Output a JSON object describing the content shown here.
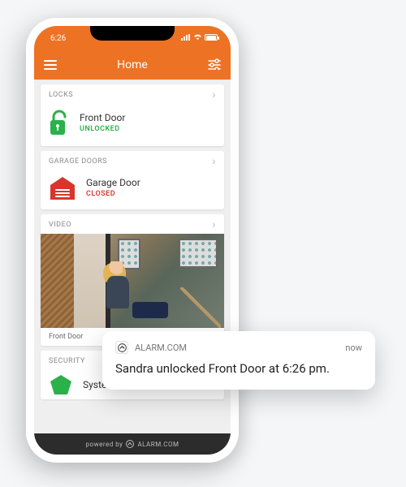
{
  "status_bar": {
    "time": "6:26"
  },
  "header": {
    "title": "Home"
  },
  "cards": {
    "locks": {
      "title": "LOCKS",
      "device": "Front Door",
      "status": "UNLOCKED"
    },
    "garage": {
      "title": "GARAGE DOORS",
      "device": "Garage Door",
      "status": "CLOSED"
    },
    "video": {
      "title": "VIDEO",
      "caption": "Front Door"
    },
    "security": {
      "title": "SECURITY",
      "device": "System"
    }
  },
  "footer": {
    "prefix": "powered by",
    "brand": "ALARM.COM"
  },
  "notification": {
    "app": "ALARM.COM",
    "when": "now",
    "message": "Sandra unlocked Front Door at 6:26 pm."
  }
}
